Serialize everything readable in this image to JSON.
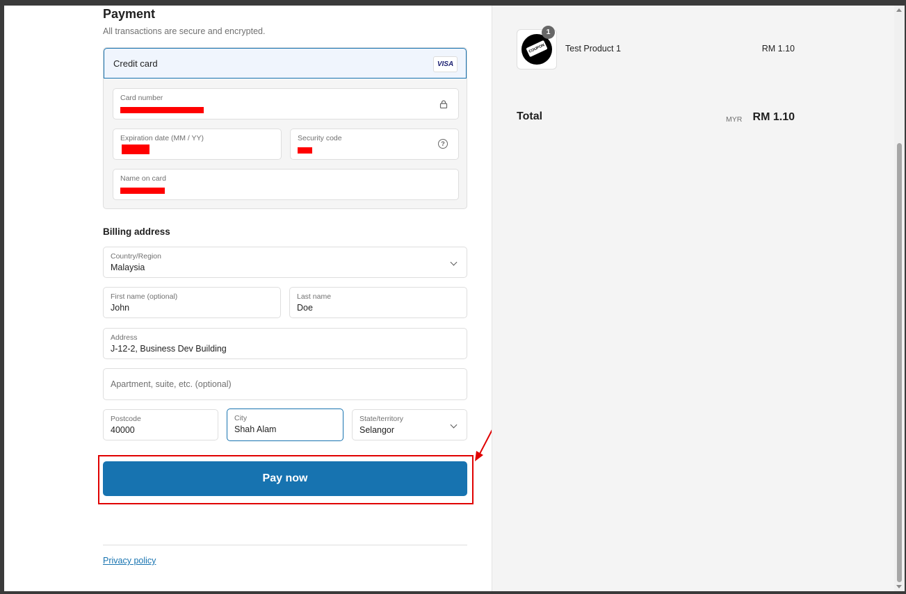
{
  "payment": {
    "title": "Payment",
    "subtitle": "All transactions are secure and encrypted.",
    "method_label": "Credit card",
    "card_brand": "VISA",
    "card_number_label": "Card number",
    "expiry_label": "Expiration date (MM / YY)",
    "security_label": "Security code",
    "name_label": "Name on card"
  },
  "billing": {
    "title": "Billing address",
    "country_label": "Country/Region",
    "country_value": "Malaysia",
    "first_name_label": "First name (optional)",
    "first_name_value": "John",
    "last_name_label": "Last name",
    "last_name_value": "Doe",
    "address_label": "Address",
    "address_value": "J-12-2, Business Dev Building",
    "apartment_placeholder": "Apartment, suite, etc. (optional)",
    "postcode_label": "Postcode",
    "postcode_value": "40000",
    "city_label": "City",
    "city_value": "Shah Alam",
    "state_label": "State/territory",
    "state_value": "Selangor"
  },
  "actions": {
    "pay_label": "Pay now",
    "privacy_label": "Privacy policy"
  },
  "summary": {
    "product_name": "Test Product 1",
    "product_qty": "1",
    "product_price": "RM 1.10",
    "product_image_text": "COUPON",
    "total_label": "Total",
    "currency": "MYR",
    "total_value": "RM 1.10"
  },
  "colors": {
    "accent": "#1773b0",
    "annotation": "#e00000",
    "redaction": "#ff0000"
  },
  "icons": [
    "lock-icon",
    "help-circle-icon",
    "chevron-down-icon",
    "visa-logo"
  ]
}
